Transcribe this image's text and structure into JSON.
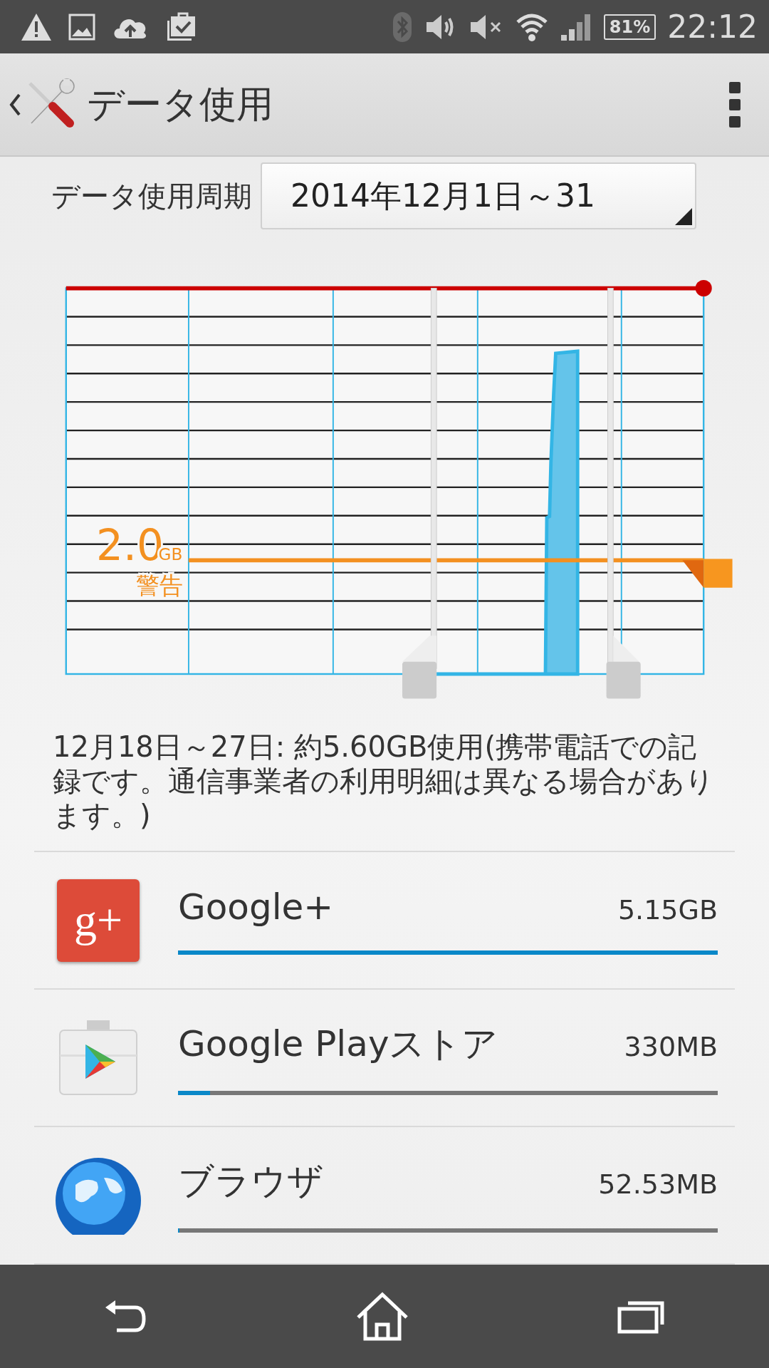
{
  "status_bar": {
    "battery": "81%",
    "time": "22:12"
  },
  "action_bar": {
    "title": "データ使用"
  },
  "cycle": {
    "label": "データ使用周期",
    "value": "2014年12月1日～31"
  },
  "warning": {
    "value": "2.0",
    "unit": "GB",
    "label": "警告"
  },
  "summary": "12月18日～27日: 約5.60GB使用(携帯電話での記録です。通信事業者の利用明細は異なる場合があります。)",
  "apps": [
    {
      "kind": "gplus",
      "icon_text": "g+",
      "name": "Google+",
      "usage": "5.15GB",
      "level": 1.0
    },
    {
      "kind": "play",
      "name": "Google Playストア",
      "usage": "330MB",
      "level": 0.06
    },
    {
      "kind": "browser",
      "name": "ブラウザ",
      "usage": "52.53MB",
      "level": 0.0
    }
  ]
}
